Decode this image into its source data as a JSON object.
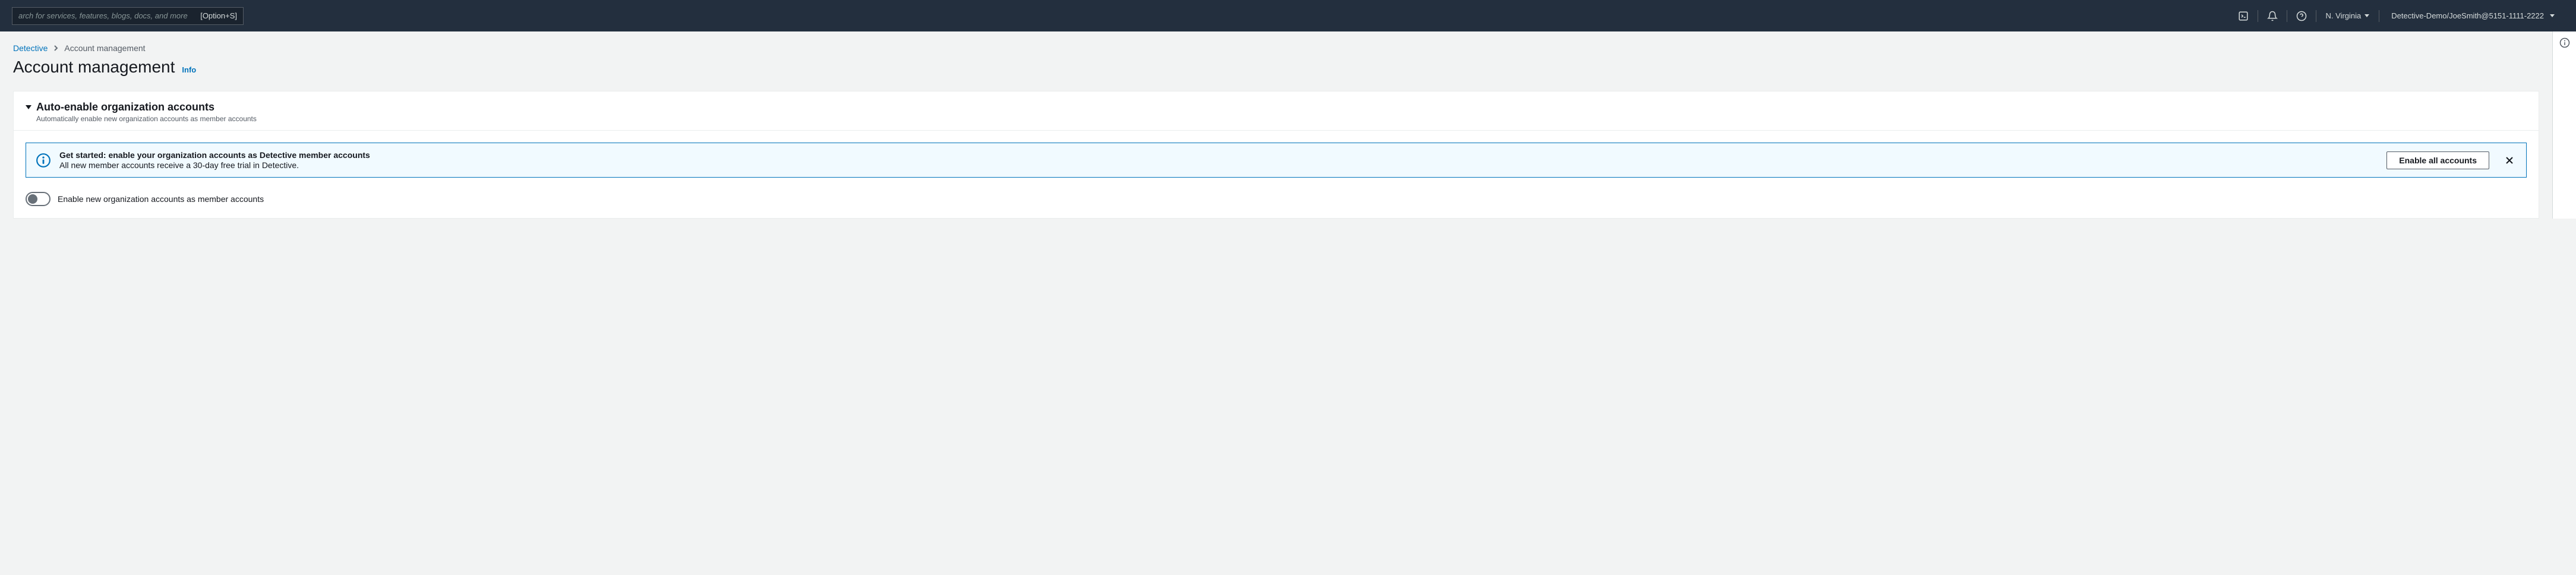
{
  "topbar": {
    "search_placeholder": "arch for services, features, blogs, docs, and more",
    "search_shortcut": "[Option+S]",
    "region": "N. Virginia",
    "account": "Detective-Demo/JoeSmith@5151-1111-2222"
  },
  "breadcrumb": {
    "root": "Detective",
    "current": "Account management"
  },
  "page": {
    "title": "Account management",
    "info_label": "Info"
  },
  "panel": {
    "title": "Auto-enable organization accounts",
    "description": "Automatically enable new organization accounts as member accounts"
  },
  "banner": {
    "title": "Get started: enable your organization accounts as Detective member accounts",
    "description": "All new member accounts receive a 30-day free trial in Detective.",
    "button_label": "Enable all accounts"
  },
  "toggle": {
    "label": "Enable new organization accounts as member accounts"
  }
}
